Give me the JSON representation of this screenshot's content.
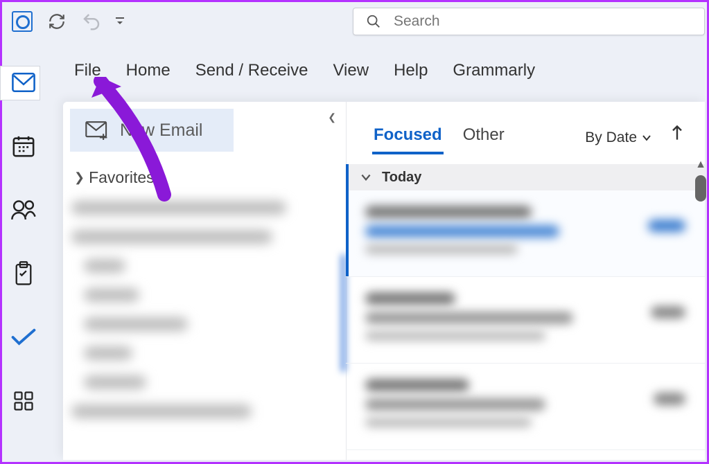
{
  "topbar": {
    "search_placeholder": "Search"
  },
  "ribbon": {
    "tabs": [
      "File",
      "Home",
      "Send / Receive",
      "View",
      "Help",
      "Grammarly"
    ]
  },
  "left_rail": {
    "items": [
      "mail",
      "calendar",
      "people",
      "clipboard",
      "todo",
      "apps"
    ]
  },
  "folders": {
    "new_email_label": "New Email",
    "favorites_label": "Favorites"
  },
  "messages": {
    "tab_focused": "Focused",
    "tab_other": "Other",
    "sort_label": "By Date",
    "group_today": "Today"
  },
  "annotation": {
    "arrow_target": "File tab",
    "arrow_color": "#8a19d8"
  }
}
